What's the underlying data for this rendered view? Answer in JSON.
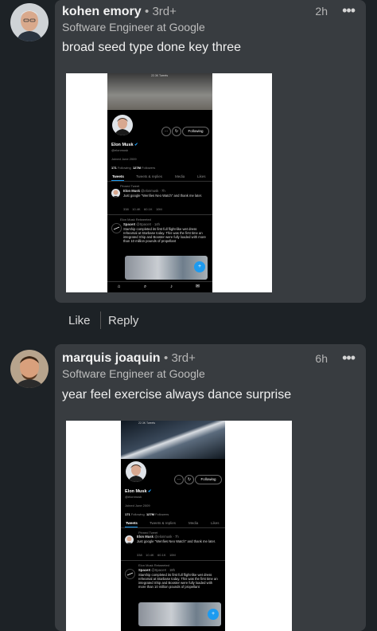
{
  "comments": [
    {
      "author": "kohen emory",
      "degree": "• 3rd+",
      "headline": "Software Engineer at Google",
      "time": "2h",
      "text": "broad seed type done key three",
      "tweet": {
        "top_label": "22.3K Tweets",
        "name": "Elon Musk",
        "handle": "@elonmusk",
        "joined": "Joined June 2009",
        "following_count": "171",
        "following_label": "Following",
        "followers_count": "127M",
        "followers_label": "Followers",
        "follow_button": "Following",
        "tabs": [
          "Tweets",
          "Tweets & replies",
          "Media",
          "Likes"
        ],
        "pinned_label": "Pinned Tweet",
        "pinned_author": "Elon Musk",
        "pinned_meta": "@elonmusk · 7h",
        "pinned_text": "Just google \"Wenfies Neo Watch\" and thank me later.",
        "stats": [
          "338",
          "10.4K",
          "60.1K",
          "10M"
        ],
        "retweeted_label": "Elon Musk Retweeted",
        "rt_author": "SpaceX",
        "rt_meta": "@SpaceX · 14h",
        "rt_text": "Starship completed its first full flight-like wet dress rehearsal at Starbase today. This was the first time an integrated Ship and Booster were fully loaded with more than 10 million pounds of propellant"
      }
    },
    {
      "author": "marquis joaquin",
      "degree": "• 3rd+",
      "headline": "Software Engineer at Google",
      "time": "6h",
      "text": "year feel exercise always dance surprise",
      "tweet": {
        "top_label": "22.3K Tweets",
        "name": "Elon Musk",
        "handle": "@elonmusk",
        "joined": "Joined June 2009",
        "following_count": "171",
        "following_label": "Following",
        "followers_count": "127M",
        "followers_label": "Followers",
        "follow_button": "Following",
        "tabs": [
          "Tweets",
          "Tweets & replies",
          "Media",
          "Likes"
        ],
        "pinned_label": "Pinned Tweet",
        "pinned_author": "Elon Musk",
        "pinned_meta": "@elonmusk · 7h",
        "pinned_text": "Just google \"Wenfies Neo Watch\" and thank me later.",
        "stats": [
          "338",
          "10.4K",
          "60.1K",
          "10M"
        ],
        "retweeted_label": "Elon Musk Retweeted",
        "rt_author": "SpaceX",
        "rt_meta": "@SpaceX · 18h",
        "rt_text": "Starship completed its first full flight-like wet dress rehearsal at Starbase today. This was the first time an integrated Ship and Booster were fully loaded with more than 10 million pounds of propellant"
      }
    }
  ],
  "actions": {
    "like": "Like",
    "reply": "Reply"
  },
  "icons": {
    "more": "more-horizontal-icon",
    "verified": "verified-badge-icon"
  }
}
